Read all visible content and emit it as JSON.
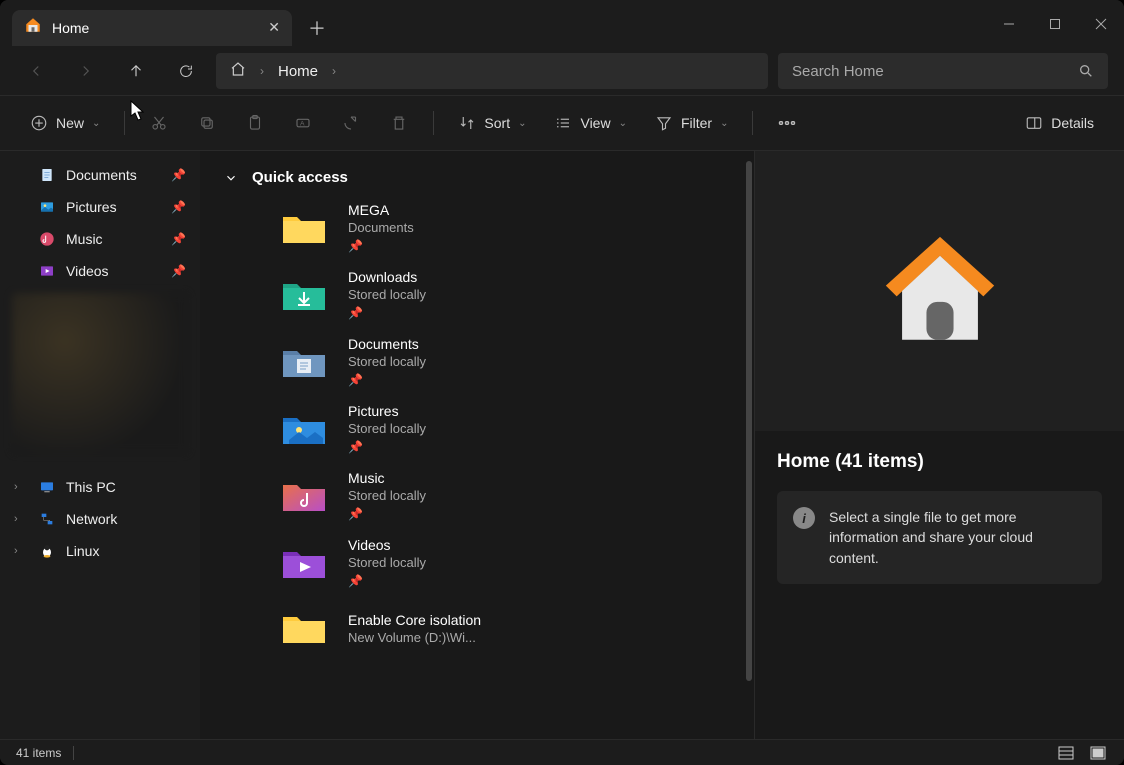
{
  "tab": {
    "title": "Home"
  },
  "address": {
    "location": "Home"
  },
  "search": {
    "placeholder": "Search Home"
  },
  "toolbar": {
    "new": "New",
    "sort": "Sort",
    "view": "View",
    "filter": "Filter",
    "details": "Details"
  },
  "sidebar": {
    "pinned": [
      {
        "label": "Documents",
        "icon": "documents"
      },
      {
        "label": "Pictures",
        "icon": "pictures"
      },
      {
        "label": "Music",
        "icon": "music"
      },
      {
        "label": "Videos",
        "icon": "videos"
      }
    ],
    "tree": [
      {
        "label": "This PC",
        "icon": "pc"
      },
      {
        "label": "Network",
        "icon": "network"
      },
      {
        "label": "Linux",
        "icon": "linux"
      }
    ]
  },
  "quick_access": {
    "header": "Quick access",
    "items": [
      {
        "name": "MEGA",
        "location": "Documents",
        "pinned": true,
        "icon": "folder-yellow"
      },
      {
        "name": "Downloads",
        "location": "Stored locally",
        "pinned": true,
        "icon": "downloads"
      },
      {
        "name": "Documents",
        "location": "Stored locally",
        "pinned": true,
        "icon": "documents-folder"
      },
      {
        "name": "Pictures",
        "location": "Stored locally",
        "pinned": true,
        "icon": "pictures-folder"
      },
      {
        "name": "Music",
        "location": "Stored locally",
        "pinned": true,
        "icon": "music-folder"
      },
      {
        "name": "Videos",
        "location": "Stored locally",
        "pinned": true,
        "icon": "videos-folder"
      },
      {
        "name": "Enable Core isolation",
        "location": "New Volume (D:)\\Wi...",
        "pinned": false,
        "icon": "folder-yellow"
      }
    ]
  },
  "preview": {
    "title": "Home (41 items)",
    "info": "Select a single file to get more information and share your cloud content."
  },
  "status": {
    "count": "41 items"
  }
}
